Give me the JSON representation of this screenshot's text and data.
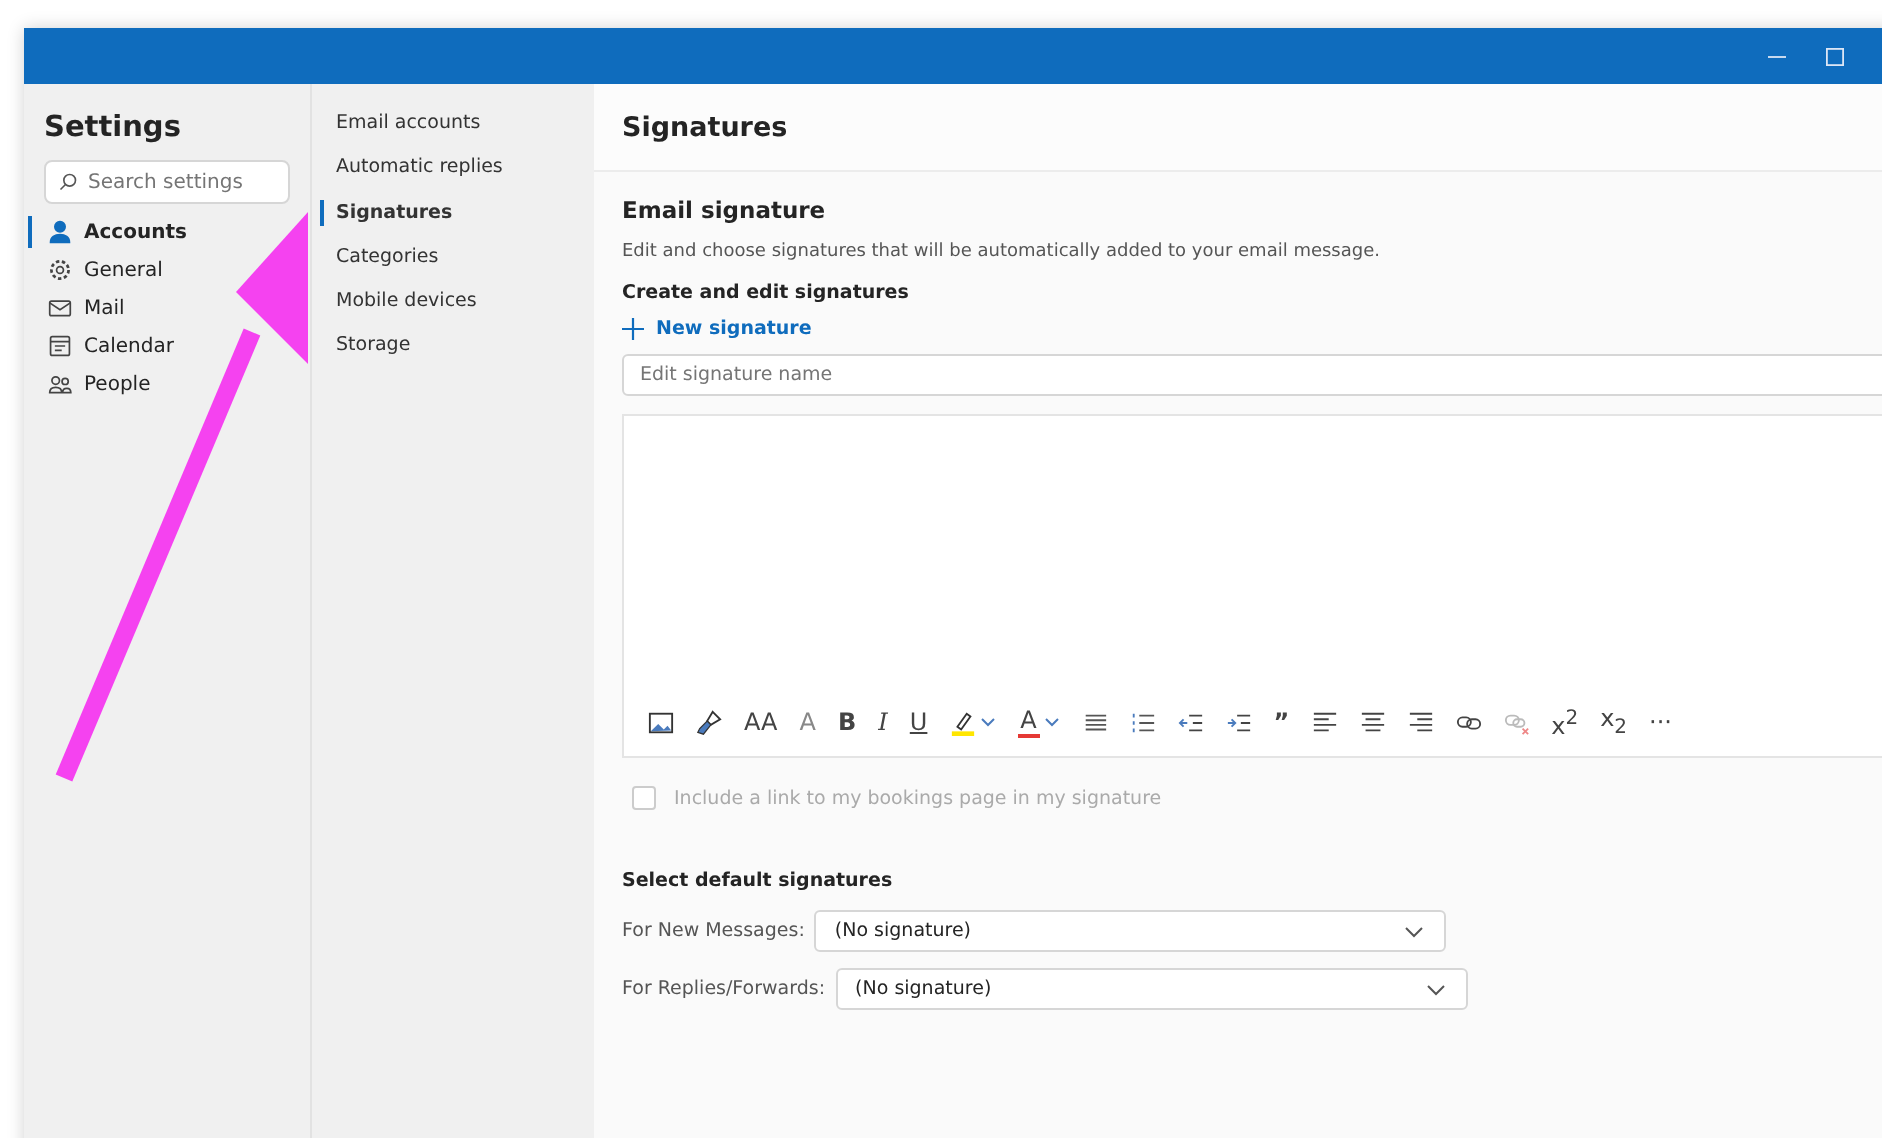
{
  "window": {
    "controls": [
      {
        "kind": "minimize"
      },
      {
        "kind": "maximize"
      }
    ]
  },
  "settings": {
    "title": "Settings",
    "search": {
      "placeholder": "Search settings"
    },
    "items": [
      {
        "label": "Accounts",
        "kind": "person",
        "selected": true
      },
      {
        "label": "General",
        "kind": "gear",
        "selected": false
      },
      {
        "label": "Mail",
        "kind": "mail",
        "selected": false
      },
      {
        "label": "Calendar",
        "kind": "calendar",
        "selected": false
      },
      {
        "label": "People",
        "kind": "people",
        "selected": false
      }
    ]
  },
  "subnav": {
    "items": [
      {
        "label": "Email accounts",
        "selected": false
      },
      {
        "label": "Automatic replies",
        "selected": false
      },
      {
        "label": "Signatures",
        "selected": true
      },
      {
        "label": "Categories",
        "selected": false
      },
      {
        "label": "Mobile devices",
        "selected": false
      },
      {
        "label": "Storage",
        "selected": false
      }
    ]
  },
  "content": {
    "title": "Signatures",
    "section": "Email signature",
    "description": "Edit and choose signatures that will be automatically added to your email message.",
    "subheading": "Create and edit signatures",
    "new_button": "New signature",
    "name_field": {
      "placeholder": "Edit signature name"
    },
    "toolbar": [
      {
        "kind": "image"
      },
      {
        "kind": "brush"
      },
      {
        "kind": "text",
        "label": "AA"
      },
      {
        "kind": "grow",
        "label": "A"
      },
      {
        "kind": "bold",
        "label": "B"
      },
      {
        "kind": "italic",
        "label": "I"
      },
      {
        "kind": "underline",
        "label": "U"
      },
      {
        "kind": "highlight",
        "color": "#ffe600"
      },
      {
        "kind": "fontcolor",
        "label": "A",
        "color": "#e53935"
      },
      {
        "kind": "bullets"
      },
      {
        "kind": "numbering"
      },
      {
        "kind": "outdent"
      },
      {
        "kind": "indent"
      },
      {
        "kind": "bold",
        "label": "”"
      },
      {
        "kind": "align-left"
      },
      {
        "kind": "align-center"
      },
      {
        "kind": "align-right"
      },
      {
        "kind": "link"
      },
      {
        "kind": "unlink"
      },
      {
        "kind": "text",
        "label": "x$^{2}$"
      },
      {
        "kind": "text",
        "label": "x$_{2}$"
      },
      {
        "kind": "text",
        "label": "···"
      }
    ],
    "bookings": {
      "label": "Include a link to my bookings page in my signature",
      "checked": false,
      "disabled": true
    },
    "defaults_heading": "Select default signatures",
    "defaults": [
      {
        "label": "For New Messages:",
        "value": "(No signature)"
      },
      {
        "label": "For Replies/Forwards:",
        "value": "(No signature)"
      }
    ]
  }
}
